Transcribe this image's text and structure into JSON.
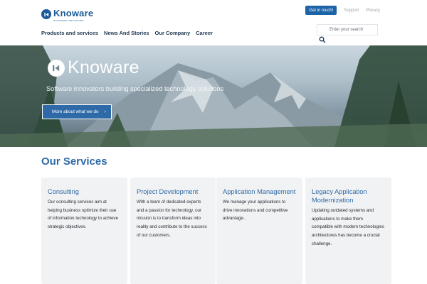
{
  "brand": {
    "name": "Knoware",
    "tagline": "SOFTWARE INNOVATORS"
  },
  "header": {
    "cta_label": "Get in touch!",
    "links": [
      "Support",
      "Privacy"
    ]
  },
  "nav": {
    "items": [
      "Products and services",
      "News And Stories",
      "Our Company",
      "Career"
    ]
  },
  "search": {
    "placeholder": "Enter your search"
  },
  "hero": {
    "logo_text": "Knoware",
    "tagline": "Software innovators building specialized technology solutions",
    "button_label": "More about what we do"
  },
  "services": {
    "title": "Our Services",
    "cards": [
      {
        "title": "Consulting",
        "body": "Our consulting services aim at helping business optimize their use of information technology to achieve strategic objectives."
      },
      {
        "title": "Project Development",
        "body": "With a team of dedicated experts and a passion for technology, our mission is to transform ideas into reality and contribute to the success of our customers."
      },
      {
        "title": "Application Management",
        "body": "We manage your applications to drive innovations and competitive advantage.."
      },
      {
        "title": "Legacy Application Modernization",
        "body": "Updating outdated systems and applications to make them compatible with modern technologies architectures has become a crucial challenge."
      }
    ]
  },
  "colors": {
    "brand_blue": "#1b5a96",
    "accent_blue": "#2d6aa9",
    "cta_blue": "#1d63a7",
    "card_bg": "#f1f2f3"
  }
}
